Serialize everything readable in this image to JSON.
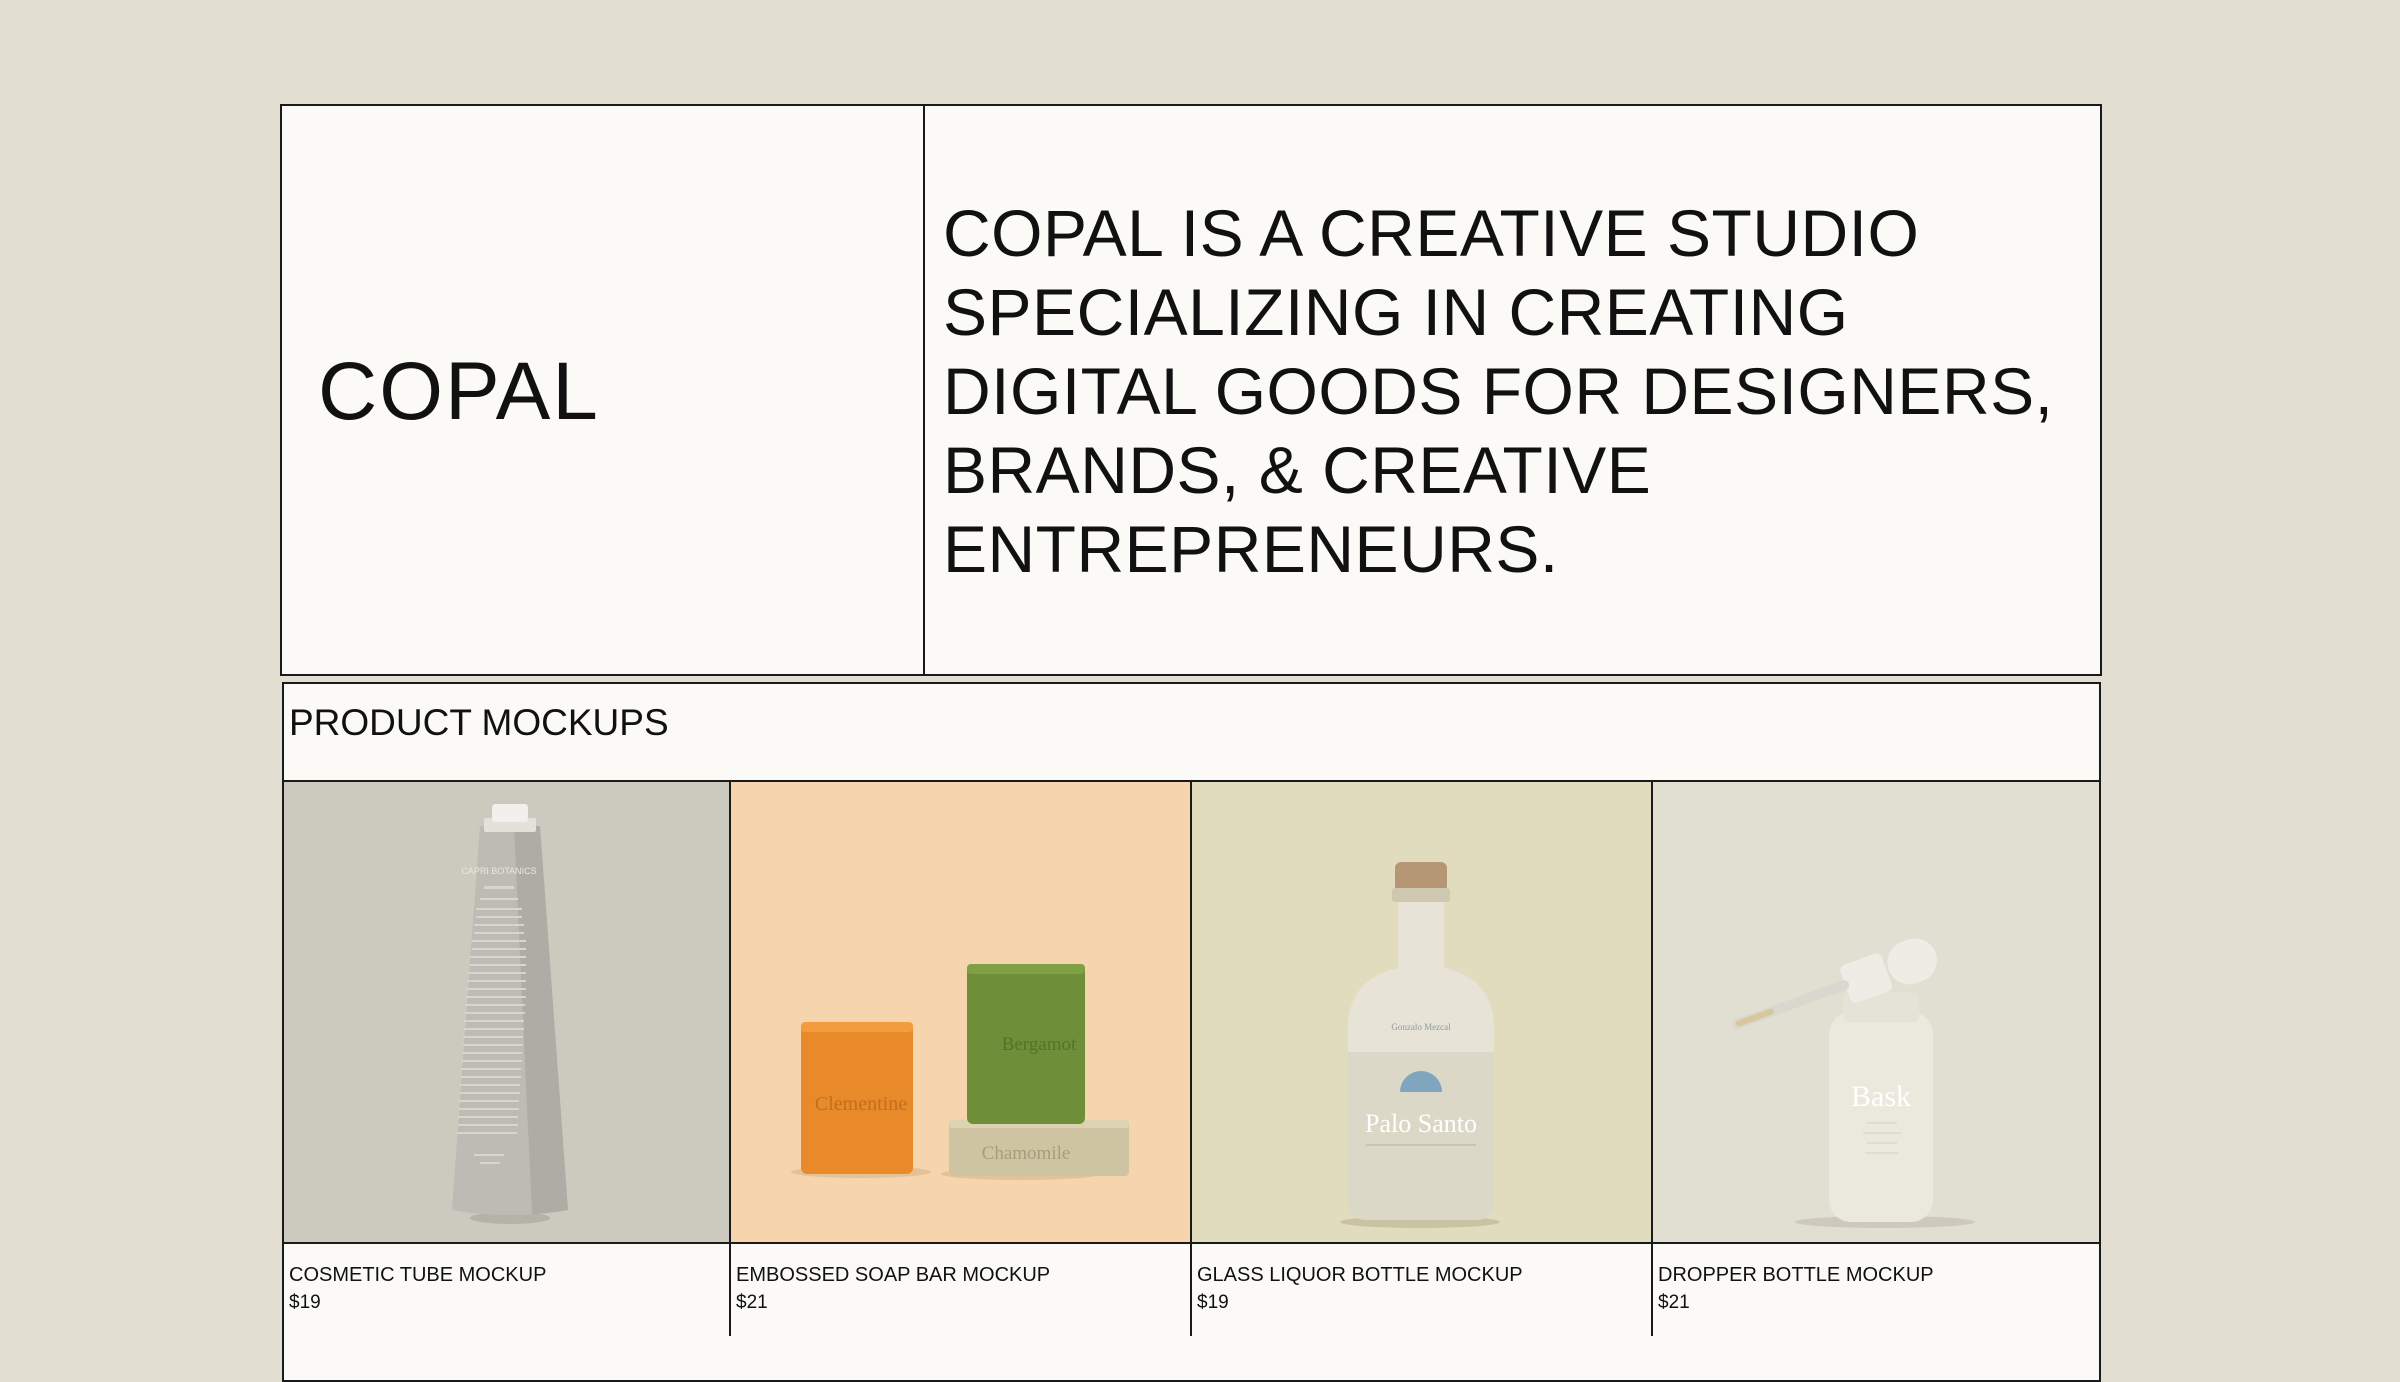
{
  "hero": {
    "logo": "COPAL",
    "tagline": "COPAL IS A CREATIVE STUDIO SPECIALIZING IN CREATING DIGITAL GOODS FOR DESIGNERS, BRANDS, & CREATIVE ENTREPRENEURS."
  },
  "products": {
    "title": "PRODUCT MOCKUPS",
    "items": [
      {
        "name": "COSMETIC TUBE MOCKUP",
        "price": "$19",
        "bg": "#ccc9bf",
        "brand": "CAPRI BOTANICS"
      },
      {
        "name": "EMBOSSED SOAP BAR MOCKUP",
        "price": "$21",
        "bg": "#f6d4ad",
        "labels": [
          "Clementine",
          "Bergamot",
          "Chamomile"
        ]
      },
      {
        "name": "GLASS LIQUOR BOTTLE MOCKUP",
        "price": "$19",
        "bg": "#e2dcbe",
        "label": "Palo Santo",
        "brand": "Gonzalo Mezcal"
      },
      {
        "name": "DROPPER BOTTLE MOCKUP",
        "price": "$21",
        "bg": "#e1ded2",
        "label": "Bask"
      }
    ]
  }
}
